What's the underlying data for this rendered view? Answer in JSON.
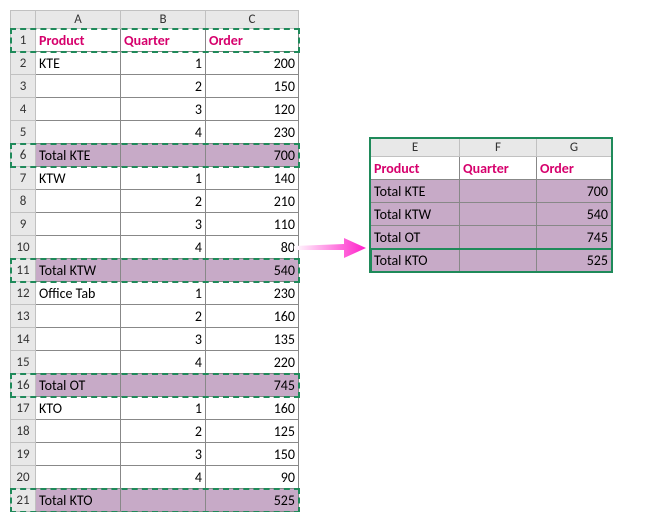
{
  "left": {
    "cols": [
      "A",
      "B",
      "C"
    ],
    "header": {
      "product": "Product",
      "quarter": "Quarter",
      "order": "Order"
    },
    "rows": [
      {
        "p": "KTE",
        "q": "1",
        "o": "200"
      },
      {
        "p": "",
        "q": "2",
        "o": "150"
      },
      {
        "p": "",
        "q": "3",
        "o": "120"
      },
      {
        "p": "",
        "q": "4",
        "o": "230"
      },
      {
        "p": "Total KTE",
        "q": "",
        "o": "700",
        "total": true
      },
      {
        "p": "KTW",
        "q": "1",
        "o": "140"
      },
      {
        "p": "",
        "q": "2",
        "o": "210"
      },
      {
        "p": "",
        "q": "3",
        "o": "110"
      },
      {
        "p": "",
        "q": "4",
        "o": "80"
      },
      {
        "p": "Total KTW",
        "q": "",
        "o": "540",
        "total": true
      },
      {
        "p": "Office Tab",
        "q": "1",
        "o": "230"
      },
      {
        "p": "",
        "q": "2",
        "o": "160"
      },
      {
        "p": "",
        "q": "3",
        "o": "135"
      },
      {
        "p": "",
        "q": "4",
        "o": "220"
      },
      {
        "p": "Total OT",
        "q": "",
        "o": "745",
        "total": true
      },
      {
        "p": "KTO",
        "q": "1",
        "o": "160"
      },
      {
        "p": "",
        "q": "2",
        "o": "125"
      },
      {
        "p": "",
        "q": "3",
        "o": "150"
      },
      {
        "p": "",
        "q": "4",
        "o": "90"
      },
      {
        "p": "Total KTO",
        "q": "",
        "o": "525",
        "total": true
      }
    ]
  },
  "right": {
    "cols": [
      "E",
      "F",
      "G"
    ],
    "header": {
      "product": "Product",
      "quarter": "Quarter",
      "order": "Order"
    },
    "rows": [
      {
        "p": "Total KTE",
        "q": "",
        "o": "700"
      },
      {
        "p": "Total KTW",
        "q": "",
        "o": "540"
      },
      {
        "p": "Total OT",
        "q": "",
        "o": "745"
      },
      {
        "p": "Total KTO",
        "q": "",
        "o": "525"
      }
    ]
  },
  "chart_data": {
    "type": "table",
    "title": "Copy filtered/subtotal rows to another range",
    "source_columns": [
      "Product",
      "Quarter",
      "Order"
    ],
    "source": [
      [
        "KTE",
        1,
        200
      ],
      [
        "KTE",
        2,
        150
      ],
      [
        "KTE",
        3,
        120
      ],
      [
        "KTE",
        4,
        230
      ],
      [
        "Total KTE",
        null,
        700
      ],
      [
        "KTW",
        1,
        140
      ],
      [
        "KTW",
        2,
        210
      ],
      [
        "KTW",
        3,
        110
      ],
      [
        "KTW",
        4,
        80
      ],
      [
        "Total KTW",
        null,
        540
      ],
      [
        "Office Tab",
        1,
        230
      ],
      [
        "Office Tab",
        2,
        160
      ],
      [
        "Office Tab",
        3,
        135
      ],
      [
        "Office Tab",
        4,
        220
      ],
      [
        "Total OT",
        null,
        745
      ],
      [
        "KTO",
        1,
        160
      ],
      [
        "KTO",
        2,
        125
      ],
      [
        "KTO",
        3,
        150
      ],
      [
        "KTO",
        4,
        90
      ],
      [
        "Total KTO",
        null,
        525
      ]
    ],
    "result_columns": [
      "Product",
      "Quarter",
      "Order"
    ],
    "result": [
      [
        "Total KTE",
        null,
        700
      ],
      [
        "Total KTW",
        null,
        540
      ],
      [
        "Total OT",
        null,
        745
      ],
      [
        "Total KTO",
        null,
        525
      ]
    ]
  }
}
